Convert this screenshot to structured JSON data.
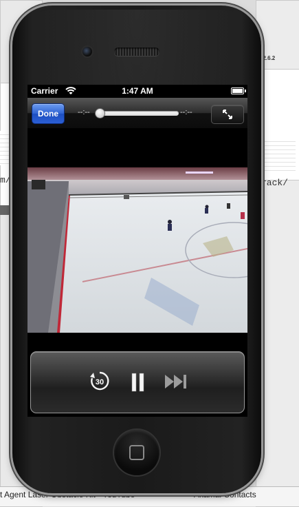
{
  "background": {
    "left_url_fragment": "m/",
    "right_url_fragment": "rack/",
    "version_label": "v2.6.2",
    "left_window_title": "t Agent Laser Obstacle Kit - YouTube",
    "right_window_title": "Akamai Contacts"
  },
  "status_bar": {
    "carrier": "Carrier",
    "time": "1:47 AM",
    "wifi_icon": "wifi-icon",
    "battery_icon": "battery-icon"
  },
  "video_toolbar": {
    "done_label": "Done",
    "elapsed": "--:--",
    "remaining": "--:--",
    "scrub_position": 0.0,
    "fullscreen_icon": "fullscreen-icon"
  },
  "video": {
    "description_icon": "video-frame"
  },
  "transport": {
    "skip_back_seconds": "30",
    "skip_back_icon": "rewind-30-icon",
    "pause_icon": "pause-icon",
    "next_icon": "next-track-icon"
  },
  "colors": {
    "done_blue": "#2f63d3",
    "rink_board_red": "#c02838",
    "ice": "#dfe3e7"
  }
}
